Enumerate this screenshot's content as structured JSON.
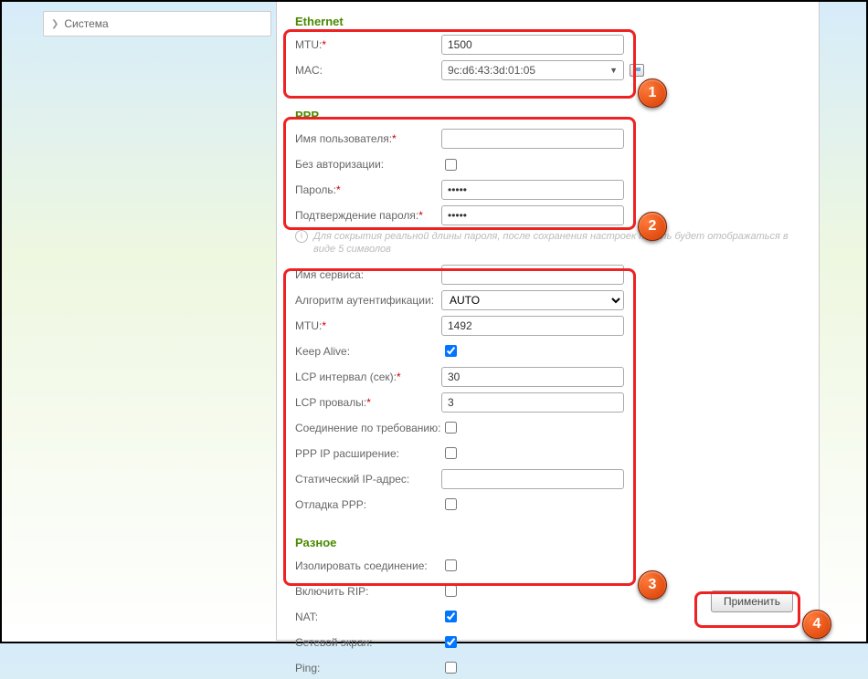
{
  "sidebar": {
    "item0": "Система"
  },
  "ethernet": {
    "title": "Ethernet",
    "mtu_label": "MTU:",
    "mtu_value": "1500",
    "mac_label": "MAC:",
    "mac_value": "9c:d6:43:3d:01:05"
  },
  "ppp": {
    "title": "PPP",
    "user_label": "Имя пользователя:",
    "user_value": "",
    "noauth_label": "Без авторизации:",
    "noauth_checked": false,
    "pass_label": "Пароль:",
    "pass_value": "•••••",
    "pass2_label": "Подтверждение пароля:",
    "pass2_value": "•••••",
    "hint": "Для сокрытия реальной длины пароля, после сохранения настроек пароль будет отображаться в виде 5 символов",
    "service_label": "Имя сервиса:",
    "service_value": "",
    "algo_label": "Алгоритм аутентификации:",
    "algo_value": "AUTO",
    "mtu2_label": "MTU:",
    "mtu2_value": "1492",
    "keepalive_label": "Keep Alive:",
    "keepalive_checked": true,
    "lcp_int_label": "LCP интервал (сек):",
    "lcp_int_value": "30",
    "lcp_fail_label": "LCP провалы:",
    "lcp_fail_value": "3",
    "ondemand_label": "Соединение по требованию:",
    "ondemand_checked": false,
    "pppip_label": "PPP IP расширение:",
    "pppip_checked": false,
    "static_label": "Статический IP-адрес:",
    "static_value": "",
    "debug_label": "Отладка PPP:",
    "debug_checked": false
  },
  "misc": {
    "title": "Разное",
    "isolate_label": "Изолировать соединение:",
    "isolate_checked": false,
    "rip_label": "Включить RIP:",
    "rip_checked": false,
    "nat_label": "NAT:",
    "nat_checked": true,
    "fw_label": "Сетевой экран:",
    "fw_checked": true,
    "ping_label": "Ping:",
    "ping_checked": false
  },
  "apply_label": "Применить",
  "badges": {
    "b1": "1",
    "b2": "2",
    "b3": "3",
    "b4": "4"
  }
}
